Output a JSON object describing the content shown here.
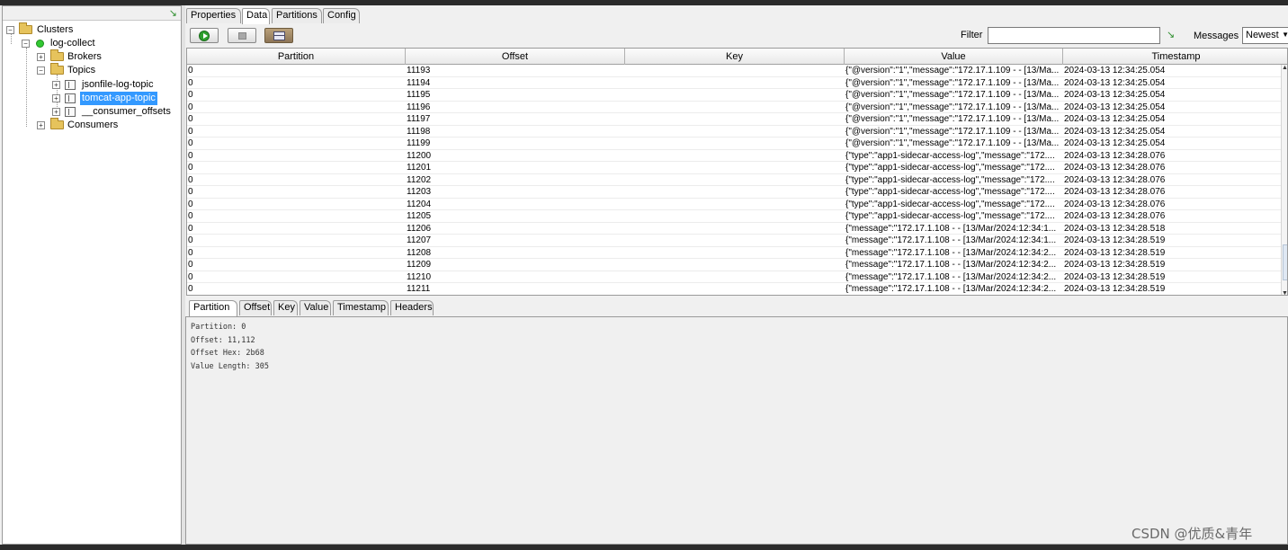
{
  "tree": {
    "root": "Clusters",
    "cluster": "log-collect",
    "brokers": "Brokers",
    "topics": "Topics",
    "topic_list": [
      "jsonfile-log-topic",
      "tomcat-app-topic",
      "__consumer_offsets"
    ],
    "consumers": "Consumers"
  },
  "top_tabs": [
    "Properties",
    "Data",
    "Partitions",
    "Config"
  ],
  "toolbar": {
    "filter_label": "Filter",
    "filter_value": "",
    "messages_label": "Messages",
    "messages_value": "Newest"
  },
  "table": {
    "columns": [
      "Partition",
      "Offset",
      "Key",
      "Value",
      "Timestamp"
    ],
    "rows": [
      [
        "0",
        "11193",
        "",
        "{\"@version\":\"1\",\"message\":\"172.17.1.109 - - [13/Ma...",
        "2024-03-13 12:34:25.054"
      ],
      [
        "0",
        "11194",
        "",
        "{\"@version\":\"1\",\"message\":\"172.17.1.109 - - [13/Ma...",
        "2024-03-13 12:34:25.054"
      ],
      [
        "0",
        "11195",
        "",
        "{\"@version\":\"1\",\"message\":\"172.17.1.109 - - [13/Ma...",
        "2024-03-13 12:34:25.054"
      ],
      [
        "0",
        "11196",
        "",
        "{\"@version\":\"1\",\"message\":\"172.17.1.109 - - [13/Ma...",
        "2024-03-13 12:34:25.054"
      ],
      [
        "0",
        "11197",
        "",
        "{\"@version\":\"1\",\"message\":\"172.17.1.109 - - [13/Ma...",
        "2024-03-13 12:34:25.054"
      ],
      [
        "0",
        "11198",
        "",
        "{\"@version\":\"1\",\"message\":\"172.17.1.109 - - [13/Ma...",
        "2024-03-13 12:34:25.054"
      ],
      [
        "0",
        "11199",
        "",
        "{\"@version\":\"1\",\"message\":\"172.17.1.109 - - [13/Ma...",
        "2024-03-13 12:34:25.054"
      ],
      [
        "0",
        "11200",
        "",
        "{\"type\":\"app1-sidecar-access-log\",\"message\":\"172....",
        "2024-03-13 12:34:28.076"
      ],
      [
        "0",
        "11201",
        "",
        "{\"type\":\"app1-sidecar-access-log\",\"message\":\"172....",
        "2024-03-13 12:34:28.076"
      ],
      [
        "0",
        "11202",
        "",
        "{\"type\":\"app1-sidecar-access-log\",\"message\":\"172....",
        "2024-03-13 12:34:28.076"
      ],
      [
        "0",
        "11203",
        "",
        "{\"type\":\"app1-sidecar-access-log\",\"message\":\"172....",
        "2024-03-13 12:34:28.076"
      ],
      [
        "0",
        "11204",
        "",
        "{\"type\":\"app1-sidecar-access-log\",\"message\":\"172....",
        "2024-03-13 12:34:28.076"
      ],
      [
        "0",
        "11205",
        "",
        "{\"type\":\"app1-sidecar-access-log\",\"message\":\"172....",
        "2024-03-13 12:34:28.076"
      ],
      [
        "0",
        "11206",
        "",
        "{\"message\":\"172.17.1.108 - - [13/Mar/2024:12:34:1...",
        "2024-03-13 12:34:28.518"
      ],
      [
        "0",
        "11207",
        "",
        "{\"message\":\"172.17.1.108 - - [13/Mar/2024:12:34:1...",
        "2024-03-13 12:34:28.519"
      ],
      [
        "0",
        "11208",
        "",
        "{\"message\":\"172.17.1.108 - - [13/Mar/2024:12:34:2...",
        "2024-03-13 12:34:28.519"
      ],
      [
        "0",
        "11209",
        "",
        "{\"message\":\"172.17.1.108 - - [13/Mar/2024:12:34:2...",
        "2024-03-13 12:34:28.519"
      ],
      [
        "0",
        "11210",
        "",
        "{\"message\":\"172.17.1.108 - - [13/Mar/2024:12:34:2...",
        "2024-03-13 12:34:28.519"
      ],
      [
        "0",
        "11211",
        "",
        "{\"message\":\"172.17.1.108 - - [13/Mar/2024:12:34:2...",
        "2024-03-13 12:34:28.519"
      ]
    ]
  },
  "detail_tabs": [
    "Partition",
    "Offset",
    "Key",
    "Value",
    "Timestamp",
    "Headers"
  ],
  "detail": {
    "partition": "Partition: 0",
    "offset": "Offset: 11,112",
    "offset_hex": "Offset Hex: 2b68",
    "value_length": "Value Length: 305"
  },
  "watermark": "CSDN @优质&青年",
  "colors": {
    "selection": "#3399ff",
    "status_ok": "#32c832"
  }
}
